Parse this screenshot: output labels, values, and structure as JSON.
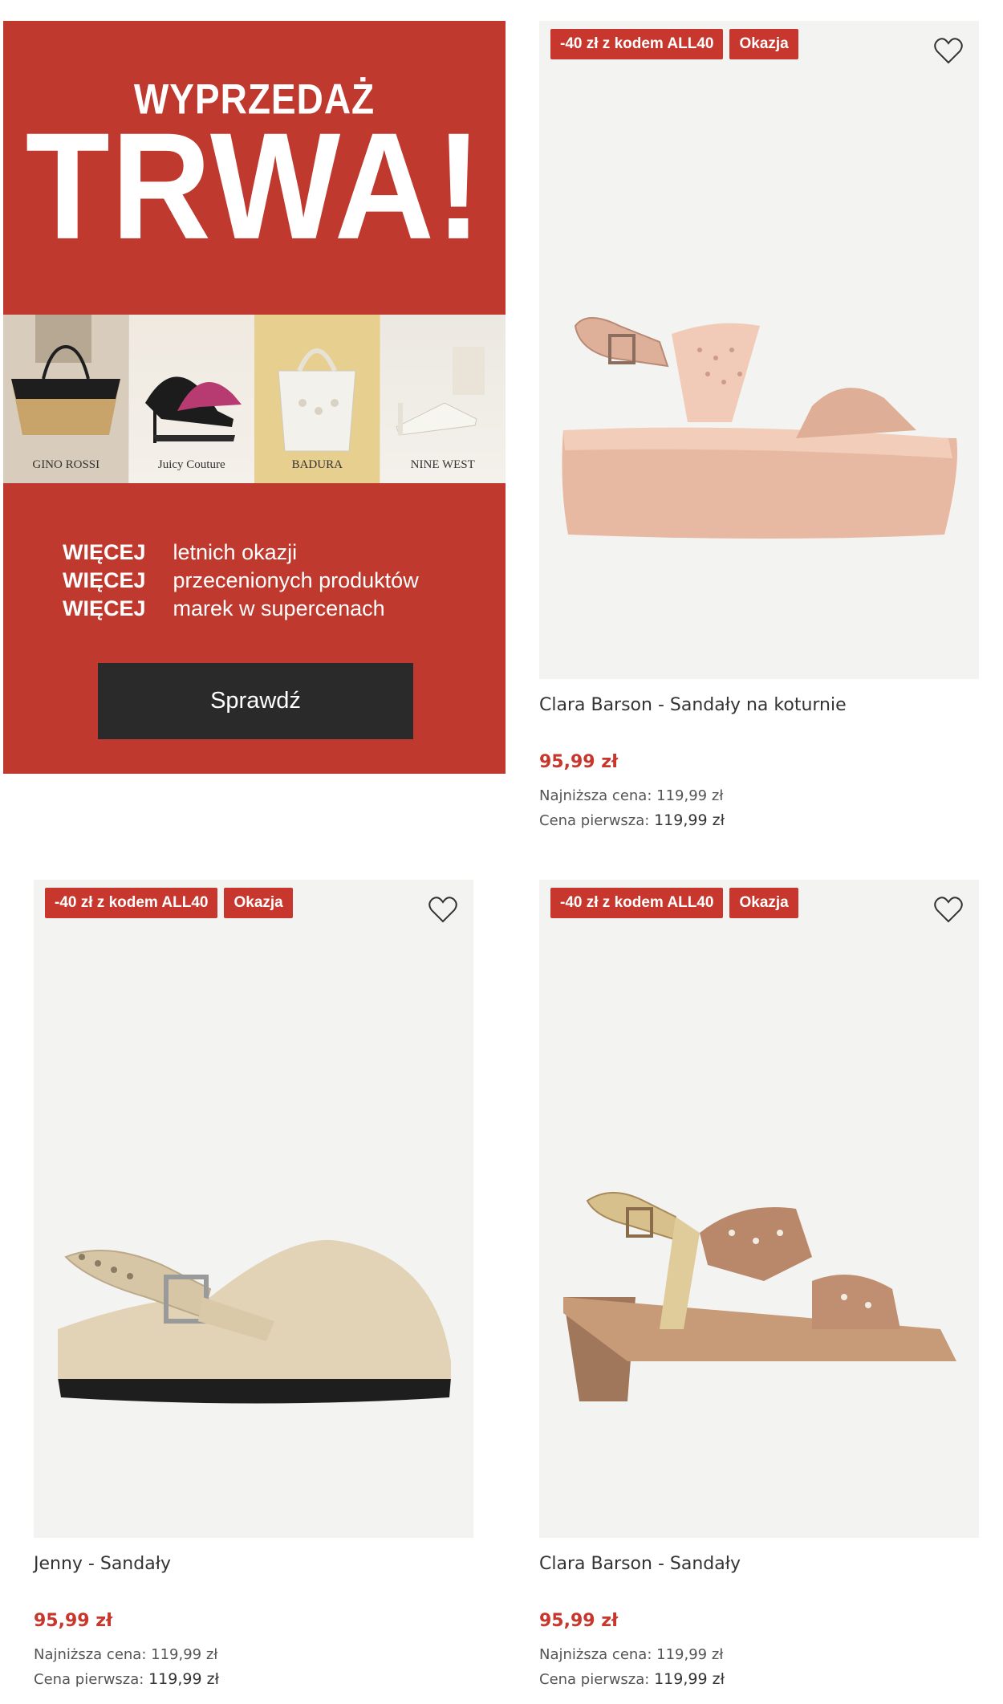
{
  "promo": {
    "subtitle": "WYPRZEDAŻ",
    "headline": "TRWA!",
    "brands": [
      "GINO ROSSI",
      "Juicy Couture",
      "BADURA",
      "NINE WEST"
    ],
    "lines": [
      {
        "keyword": "WIĘCEJ",
        "text": "letnich okazji"
      },
      {
        "keyword": "WIĘCEJ",
        "text": "przecenionych produktów"
      },
      {
        "keyword": "WIĘCEJ",
        "text": "marek w supercenach"
      }
    ],
    "cta": "Sprawdź",
    "color": "#c0392f"
  },
  "products": [
    {
      "badge_code": "-40 zł z kodem ALL40",
      "badge_deal": "Okazja",
      "title": "Clara Barson - Sandały na koturnie",
      "price": "95,99 zł",
      "lowest_label": "Najniższa cena:",
      "lowest_value": "119,99 zł",
      "first_label": "Cena pierwsza:",
      "first_value": "119,99 zł",
      "icon": "heart-icon"
    },
    {
      "badge_code": "-40 zł z kodem ALL40",
      "badge_deal": "Okazja",
      "title": "Jenny - Sandały",
      "price": "95,99 zł",
      "lowest_label": "Najniższa cena:",
      "lowest_value": "119,99 zł",
      "first_label": "Cena pierwsza:",
      "first_value": "119,99 zł",
      "icon": "heart-icon"
    },
    {
      "badge_code": "-40 zł z kodem ALL40",
      "badge_deal": "Okazja",
      "title": "Clara Barson - Sandały",
      "price": "95,99 zł",
      "lowest_label": "Najniższa cena:",
      "lowest_value": "119,99 zł",
      "first_label": "Cena pierwsza:",
      "first_value": "119,99 zł",
      "icon": "heart-icon"
    }
  ],
  "colors": {
    "badge": "#c8372d",
    "price": "#c8372d",
    "card_bg": "#f3f3f2"
  }
}
